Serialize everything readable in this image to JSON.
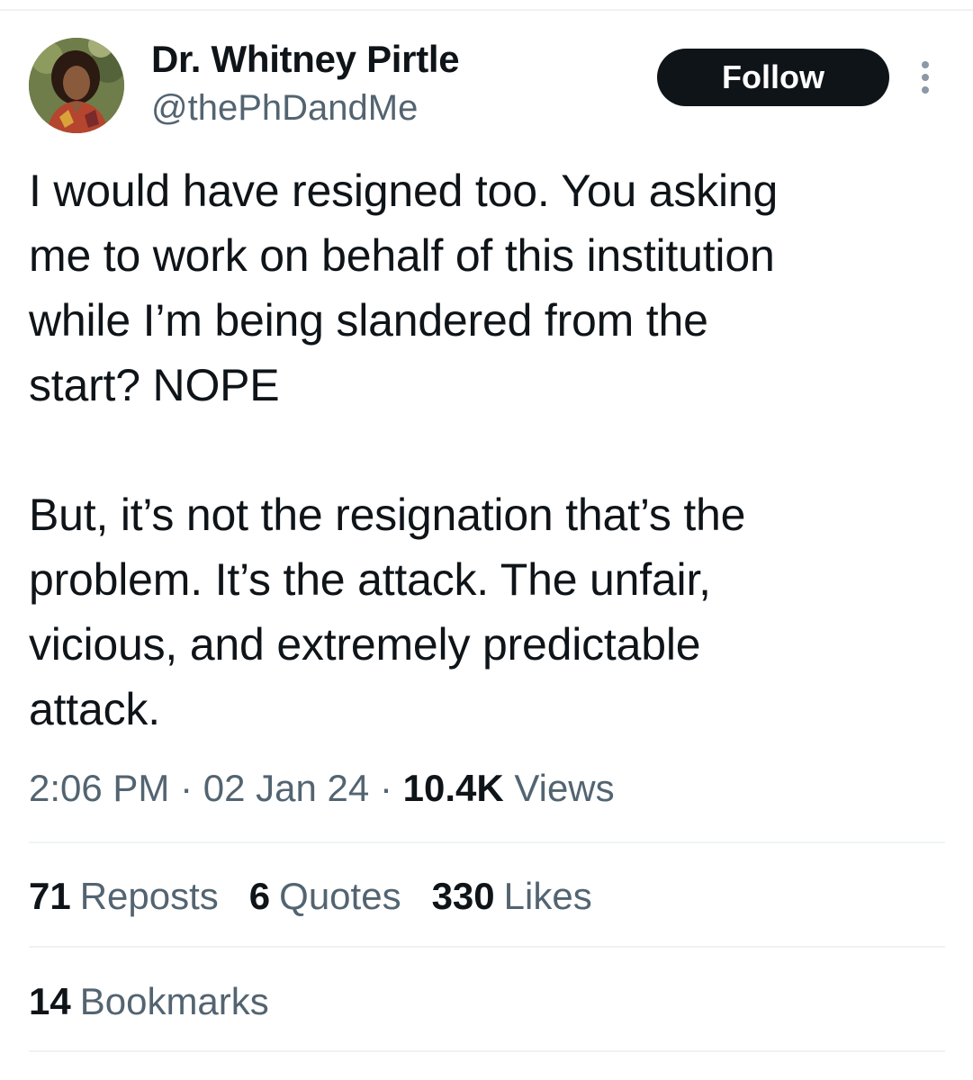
{
  "author": {
    "display_name": "Dr. Whitney Pirtle",
    "handle": "@thePhDandMe"
  },
  "actions": {
    "follow_label": "Follow",
    "more_icon": "more-vertical-icon"
  },
  "tweet": {
    "paragraphs": [
      [
        "I would have resigned too. You asking",
        "me to work on behalf of this institution",
        "while I’m being slandered from the",
        "start? NOPE"
      ],
      [
        "But, it’s not the resignation that’s the",
        "problem. It’s the attack. The unfair,",
        "vicious, and extremely predictable",
        "attack."
      ]
    ]
  },
  "meta": {
    "time": "2:06 PM",
    "separator": "·",
    "date": "02 Jan 24",
    "views_count": "10.4K",
    "views_label": "Views"
  },
  "stats": {
    "reposts_count": "71",
    "reposts_label": "Reposts",
    "quotes_count": "6",
    "quotes_label": "Quotes",
    "likes_count": "330",
    "likes_label": "Likes",
    "bookmarks_count": "14",
    "bookmarks_label": "Bookmarks"
  },
  "colors": {
    "text_primary": "#0f1419",
    "text_secondary": "#536471",
    "divider": "#eff3f4",
    "follow_button_bg": "#0f1419",
    "follow_button_text": "#ffffff"
  }
}
